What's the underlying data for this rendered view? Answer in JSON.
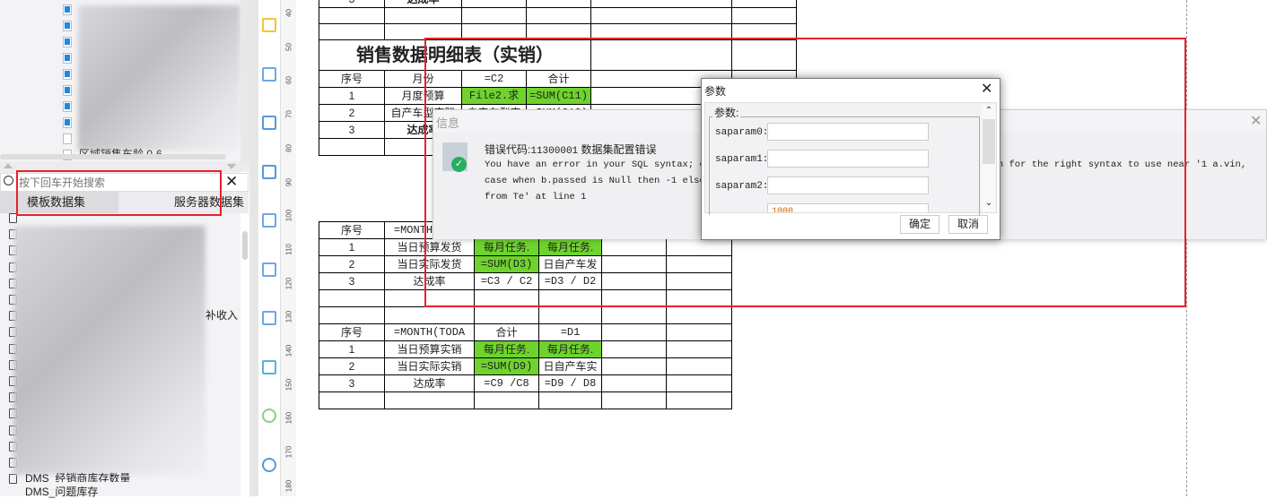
{
  "left_panel": {
    "tree_partial_item": "区域销售车龄 0-6",
    "search": {
      "placeholder": "按下回车开始搜索"
    },
    "tabs": [
      {
        "label": "模板数据集"
      },
      {
        "label": "服务器数据集"
      }
    ],
    "partial_item_right": "补收入",
    "datasets": [
      {
        "label": "DMS_经销商库存数量"
      },
      {
        "label": "DMS_问题库存"
      }
    ]
  },
  "ruler": [
    "40",
    "50",
    "60",
    "70",
    "80",
    "90",
    "100",
    "110",
    "120",
    "130",
    "140",
    "150",
    "160",
    "170",
    "180"
  ],
  "sheet": {
    "title": "销售数据明细表（实销）",
    "top_rows": [
      [
        "序号",
        "月份",
        "=C2",
        "合计"
      ],
      [
        "1",
        "月度预算",
        "File2.求",
        "=SUM(C11)"
      ],
      [
        "2",
        "自产车型实际",
        "自产车型实",
        "=SUM(C12)"
      ],
      [
        "3",
        "达成率",
        "",
        ""
      ]
    ],
    "prev_row": [
      "3",
      "达成率"
    ],
    "bottom_rows": [
      [
        "序号",
        "=MONTH(TODA",
        "",
        ""
      ],
      [
        "1",
        "当日预算发货",
        "每月任务.",
        "每月任务."
      ],
      [
        "2",
        "当日实际发货",
        "=SUM(D3)",
        "日自产车发"
      ],
      [
        "3",
        "达成率",
        "=C3 / C2",
        "=D3 / D2"
      ],
      [
        "",
        "",
        "",
        ""
      ],
      [
        "",
        "",
        "",
        ""
      ],
      [
        "序号",
        "=MONTH(TODA",
        "合计",
        "=D1"
      ],
      [
        "1",
        "当日预算实销",
        "每月任务.",
        "每月任务."
      ],
      [
        "2",
        "当日实际实销",
        "=SUM(D9)",
        "日自产车实"
      ],
      [
        "3",
        "达成率",
        "=C9 /C8",
        "=D9 / D8"
      ],
      [
        "",
        "",
        "",
        ""
      ]
    ]
  },
  "info_dialog": {
    "title": "信息",
    "error_label": "错误代码:",
    "error_code": "11300001",
    "error_title": "数据集配置错误",
    "line1_left": "You have an error in your SQL syntax; ch",
    "line1_right": "sion for the right syntax to use near '1 a.vin,",
    "line2": "case when b.passed is Null then -1 else",
    "line3": "from Te' at line 1"
  },
  "param_dialog": {
    "title": "参数",
    "group_label": "参数:",
    "params": [
      {
        "label": "saparam0:",
        "value": ""
      },
      {
        "label": "saparam1:",
        "value": ""
      },
      {
        "label": "saparam2:",
        "value": ""
      }
    ],
    "partial_value": "1000",
    "ok": "确定",
    "cancel": "取消"
  },
  "colors": {
    "highlight": "#e8212b",
    "cell_green": "#6fd32e"
  }
}
